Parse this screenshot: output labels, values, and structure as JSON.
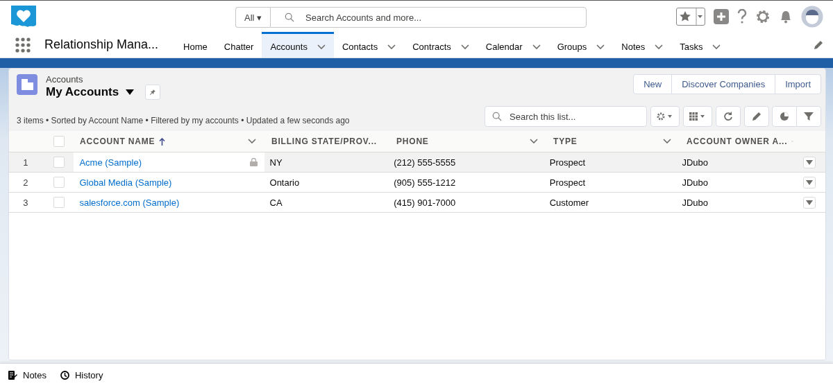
{
  "header": {
    "search_scope": "All",
    "scope_caret": "▾",
    "search": {
      "placeholder": "Search Accounts and more..."
    }
  },
  "app_name": "Relationship Mana...",
  "tabs": [
    {
      "label": "Home",
      "selected": false,
      "has_menu": false
    },
    {
      "label": "Chatter",
      "selected": false,
      "has_menu": false
    },
    {
      "label": "Accounts",
      "selected": true,
      "has_menu": true
    },
    {
      "label": "Contacts",
      "selected": false,
      "has_menu": true
    },
    {
      "label": "Contracts",
      "selected": false,
      "has_menu": true
    },
    {
      "label": "Calendar",
      "selected": false,
      "has_menu": true
    },
    {
      "label": "Groups",
      "selected": false,
      "has_menu": true
    },
    {
      "label": "Notes",
      "selected": false,
      "has_menu": true
    },
    {
      "label": "Tasks",
      "selected": false,
      "has_menu": true
    }
  ],
  "list": {
    "object": "Accounts",
    "view": "My Accounts",
    "summary": "3 items • Sorted by Account Name • Filtered by my accounts • Updated a few seconds ago",
    "buttons": [
      "New",
      "Discover Companies",
      "Import"
    ],
    "search": {
      "placeholder": "Search this list..."
    }
  },
  "table": {
    "all_checked": false,
    "columns": [
      {
        "label": "ACCOUNT NAME",
        "sorted": true
      },
      {
        "label": "BILLING STATE/PROV...",
        "sorted": false
      },
      {
        "label": "PHONE",
        "sorted": false
      },
      {
        "label": "TYPE",
        "sorted": false
      },
      {
        "label": "ACCOUNT OWNER A...",
        "sorted": false
      }
    ],
    "rows": [
      {
        "number": "1",
        "checked": false,
        "highlighted": true,
        "cells": [
          "Acme (Sample)",
          "NY",
          "(212) 555-5555",
          "Prospect",
          "JDubo"
        ]
      },
      {
        "number": "2",
        "checked": false,
        "highlighted": false,
        "cells": [
          "Global Media (Sample)",
          "Ontario",
          "(905) 555-1212",
          "Prospect",
          "JDubo"
        ]
      },
      {
        "number": "3",
        "checked": false,
        "highlighted": false,
        "cells": [
          "salesforce.com (Sample)",
          "CA",
          "(415) 901-7000",
          "Customer",
          "JDubo"
        ]
      }
    ]
  },
  "utility_bar": [
    {
      "kind": "notes",
      "label": "Notes"
    },
    {
      "kind": "history",
      "label": "History"
    }
  ]
}
